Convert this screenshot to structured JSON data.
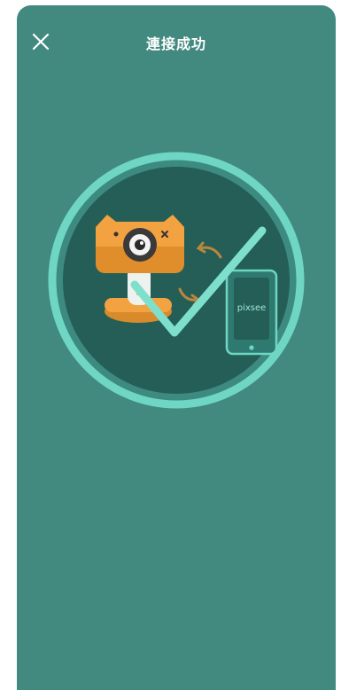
{
  "header": {
    "title": "連接成功",
    "close_icon": "close-icon"
  },
  "illustration": {
    "phone_brand": "pixsee",
    "status": "connected"
  },
  "colors": {
    "background": "#428980",
    "ring": "#6fd6c3",
    "inner_circle": "#245e56",
    "camera_orange": "#f2a240",
    "check": "#7ee0cc"
  }
}
